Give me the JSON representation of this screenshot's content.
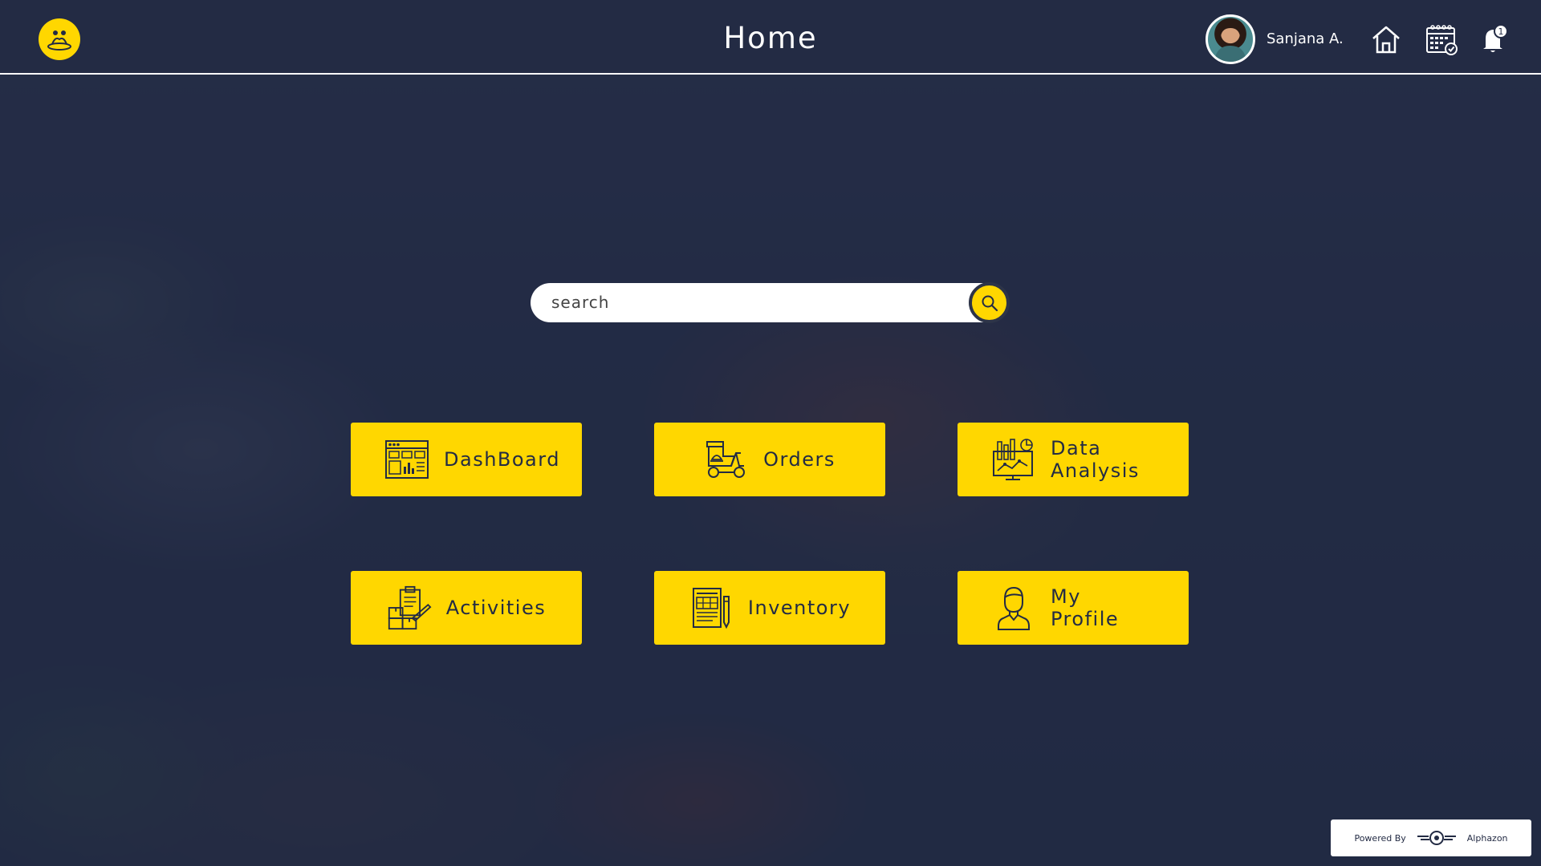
{
  "header": {
    "title": "Home",
    "user_name": "Sanjana A.",
    "icons": [
      "logo-icon",
      "home-icon",
      "calendar-icon",
      "bell-icon"
    ],
    "notification_count": "1"
  },
  "search": {
    "placeholder": "search"
  },
  "tiles": [
    {
      "label": "DashBoard",
      "icon": "dashboard-icon"
    },
    {
      "label": "Orders",
      "icon": "delivery-scooter-icon"
    },
    {
      "label": "Data Analysis",
      "icon": "data-analysis-icon"
    },
    {
      "label": "Activities",
      "icon": "activities-icon"
    },
    {
      "label": "Inventory",
      "icon": "inventory-icon"
    },
    {
      "label": "My Profile",
      "icon": "profile-icon"
    }
  ],
  "footer": {
    "powered_by": "Powered By",
    "company": "Alphazon"
  },
  "colors": {
    "accent": "#ffd700",
    "header_bg": "#232b44",
    "overlay": "#1f2842",
    "text_dark": "#232b44"
  }
}
